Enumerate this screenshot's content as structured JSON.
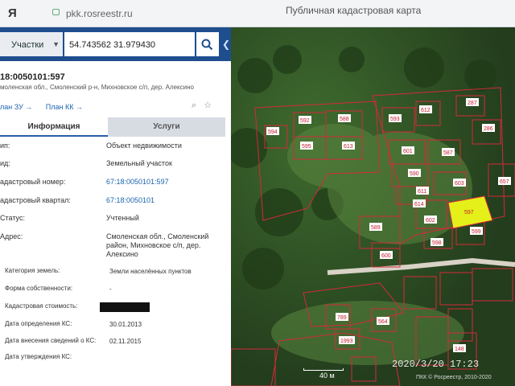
{
  "browser": {
    "app_icon": "Я",
    "url": "pkk.rosreestr.ru",
    "title": "Публичная кадастровая карта"
  },
  "search": {
    "type_label": "Участки",
    "query": "54.743562 31.979430"
  },
  "parcel": {
    "cadastral_number": "18:0050101:597",
    "address_line": "моленская обл., Смоленский р-н, Михновское с/п, дер. Алексино",
    "link_zu": "лан ЗУ →",
    "link_kk": "План КК →"
  },
  "tabs": {
    "info": "Информация",
    "services": "Услуги"
  },
  "rows": [
    {
      "k": "ип:",
      "v": "Объект недвижимости"
    },
    {
      "k": "ид:",
      "v": "Земельный участок"
    },
    {
      "k": "адастровый номер:",
      "v": "67:18:0050101:597",
      "link": true
    },
    {
      "k": "адастровый квартал:",
      "v": "67:18:0050101",
      "link": true
    },
    {
      "k": "Статус:",
      "v": "Учтенный"
    },
    {
      "k": "Адрес:",
      "v": "Смоленская обл., Смоленский район, Михновское с/п, дер. Алексино"
    }
  ],
  "rows_small": [
    {
      "k": "Категория земель:",
      "v": "Земли населённых пунктов"
    },
    {
      "k": "Форма собственности:",
      "v": "-"
    },
    {
      "k": "Кадастровая стоимость:",
      "v": ""
    },
    {
      "k": "Дата определения КС:",
      "v": "30.01.2013"
    },
    {
      "k": "Дата внесения сведений о КС:",
      "v": "02.11.2015"
    },
    {
      "k": "Дата утверждения КС:",
      "v": ""
    }
  ],
  "map": {
    "parcel_labels": [
      "592",
      "588",
      "594",
      "595",
      "613",
      "593",
      "612",
      "287",
      "601",
      "587",
      "286",
      "590",
      "603",
      "611",
      "614",
      "602",
      "597",
      "589",
      "599",
      "598",
      "600",
      "657",
      "789",
      "564",
      "1993",
      "148"
    ],
    "scale_label": "40 м",
    "timestamp": "2020/3/20  17:23",
    "copyright": "ПКК © Росреестр, 2010-2020"
  },
  "colors": {
    "header": "#1f4e8f",
    "link": "#1b64b0",
    "selected_parcel": "#e5ef1a",
    "parcel_line": "#d42a3a"
  }
}
